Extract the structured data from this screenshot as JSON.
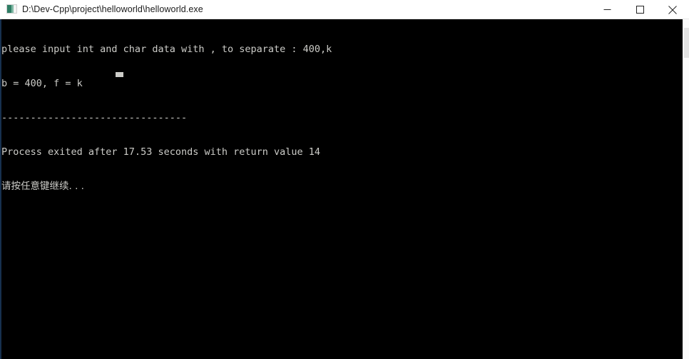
{
  "window": {
    "title": "D:\\Dev-Cpp\\project\\helloworld\\helloworld.exe",
    "icon": "console-app-icon",
    "controls": {
      "minimize_label": "Minimize",
      "maximize_label": "Maximize",
      "close_label": "Close"
    }
  },
  "console": {
    "background_color": "#000000",
    "text_color": "#ccccc8",
    "lines": [
      "please input int and char data with , to separate : 400,k",
      "b = 400, f = k",
      "--------------------------------",
      "Process exited after 17.53 seconds with return value 14",
      "请按任意键继续. . ."
    ],
    "line_1": "please input int and char data with , to separate : 400,k",
    "line_2": "b = 400, f = k",
    "line_3": "--------------------------------",
    "line_4": "Process exited after 17.53 seconds with return value 14",
    "line_5": "请按任意键继续. . .",
    "program_output": {
      "prompt": "please input int and char data with , to separate :",
      "user_input": "400,k",
      "result": "b = 400, f = k",
      "exit_seconds": "17.53",
      "return_value": "14",
      "press_any_key": "请按任意键继续. . ."
    },
    "cursor": "block-cursor"
  },
  "scrollbar": {
    "orientation": "vertical",
    "track_color": "#fbfbfb",
    "thumb_color": "#e3e3e3"
  }
}
